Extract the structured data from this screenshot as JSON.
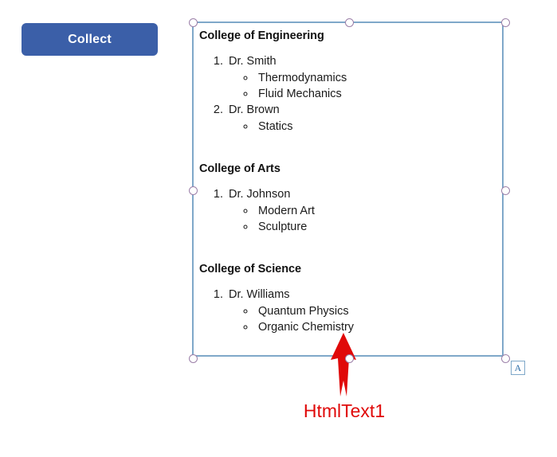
{
  "toolbar": {
    "collect_label": "Collect"
  },
  "text_control": {
    "badge_letter": "A",
    "sections": [
      {
        "heading": "College of Engineering",
        "faculty": [
          {
            "name": "Dr. Smith",
            "courses": [
              "Thermodynamics",
              "Fluid Mechanics"
            ]
          },
          {
            "name": "Dr. Brown",
            "courses": [
              "Statics"
            ]
          }
        ]
      },
      {
        "heading": "College of Arts",
        "faculty": [
          {
            "name": "Dr. Johnson",
            "courses": [
              "Modern Art",
              "Sculpture"
            ]
          }
        ]
      },
      {
        "heading": "College of Science",
        "faculty": [
          {
            "name": "Dr. Williams",
            "courses": [
              "Quantum Physics",
              "Organic Chemistry"
            ]
          }
        ]
      }
    ]
  },
  "annotation": {
    "label": "HtmlText1",
    "color": "#E00909",
    "arrow_direction": "up"
  },
  "colors": {
    "button_blue": "#3B5FA8",
    "selection_border": "#7FA8C9",
    "handle_outline": "#9B7FA8",
    "annotation_red": "#E00909",
    "text": "#1a1a1a",
    "background": "#ffffff"
  }
}
